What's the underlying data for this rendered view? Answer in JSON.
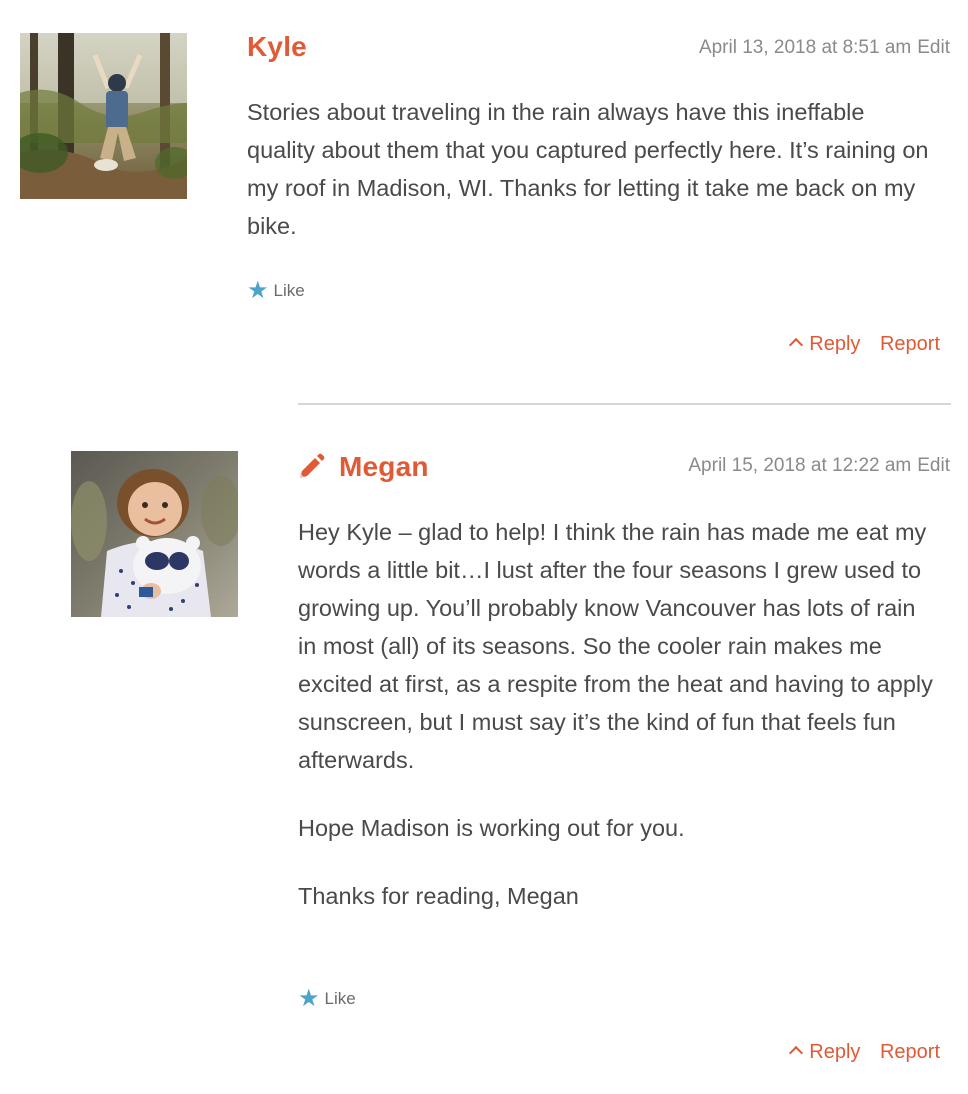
{
  "comments": [
    {
      "author": "Kyle",
      "date": "April 13, 2018 at 8:51 am",
      "edit_label": "Edit",
      "paragraphs": [
        "Stories about traveling in the rain always have this ineffable quality about them that you captured perfectly here. It’s raining on my roof in Madison, WI. Thanks for letting it take me back on my bike."
      ],
      "like_label": "Like",
      "reply_label": "Reply",
      "report_label": "Report",
      "avatar_icon": "user-photo-jumping"
    },
    {
      "author": "Megan",
      "date": "April 15, 2018 at 12:22 am",
      "edit_label": "Edit",
      "paragraphs": [
        "Hey Kyle – glad to help! I think the rain has made me eat my words a little bit…I lust after the four seasons I grew used to growing up. You’ll probably know Vancouver has lots of rain in most (all) of its seasons. So the cooler rain makes me excited at first, as a respite from the heat and having to apply sunscreen, but I must say it’s the kind of fun that feels fun afterwards.",
        "Hope Madison is working out for you.",
        "Thanks for reading, Megan"
      ],
      "like_label": "Like",
      "reply_label": "Reply",
      "report_label": "Report",
      "avatar_icon": "user-photo-child",
      "author_badge_icon": "pencil-icon"
    }
  ],
  "colors": {
    "accent": "#e05a35",
    "meta": "#8a8a8a",
    "text": "#4a4a4a",
    "like_star": "#4ea3c9",
    "divider": "#d6d6d6"
  }
}
